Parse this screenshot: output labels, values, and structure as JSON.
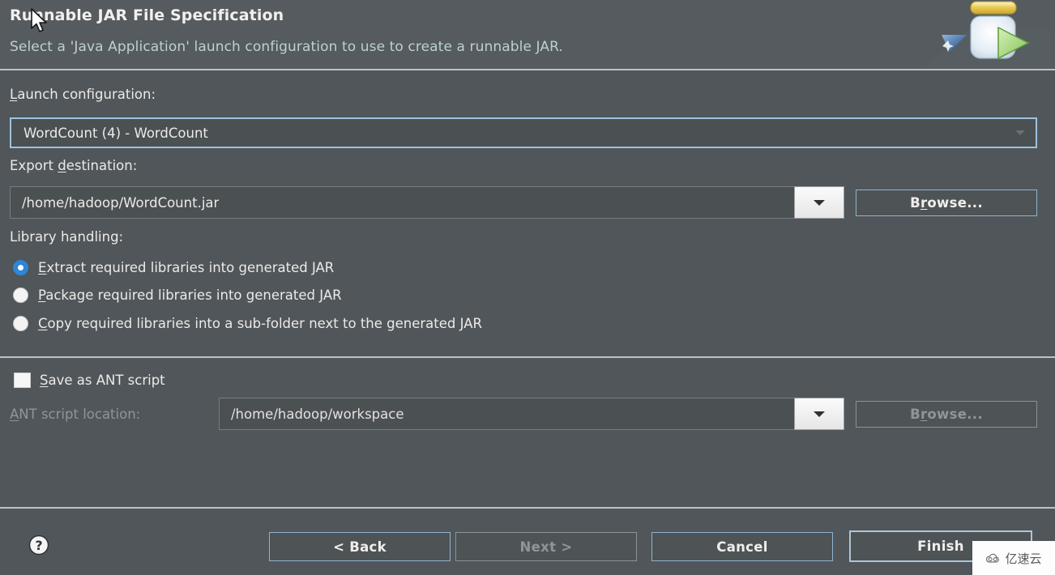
{
  "header": {
    "title": "Runnable JAR File Specification",
    "subtitle": "Select a 'Java Application' launch configuration to use to create a runnable JAR.",
    "icon": "runnable-jar-icon"
  },
  "launch_configuration": {
    "label_pre": "",
    "label_mnemonic": "L",
    "label_post": "aunch configuration:",
    "value": "WordCount (4) - WordCount",
    "dropdown_icon": "chevron-down-icon"
  },
  "export_destination": {
    "label_pre": "Export ",
    "label_mnemonic": "d",
    "label_post": "estination:",
    "value": "/home/hadoop/WordCount.jar",
    "dropdown_icon": "chevron-down-icon",
    "browse_pre": "B",
    "browse_mnemonic": "r",
    "browse_post": "owse...",
    "browse_label": "Browse..."
  },
  "library_handling": {
    "label": "Library handling:",
    "options": [
      {
        "mnemonic": "E",
        "pre": "",
        "post": "xtract required libraries into generated JAR",
        "full": "Extract required libraries into generated JAR",
        "selected": true
      },
      {
        "mnemonic": "P",
        "pre": "",
        "post": "ackage required libraries into generated JAR",
        "full": "Package required libraries into generated JAR",
        "selected": false
      },
      {
        "mnemonic": "C",
        "pre": "",
        "post": "opy required libraries into a sub-folder next to the generated JAR",
        "full": "Copy required libraries into a sub-folder next to the generated JAR",
        "selected": false
      }
    ]
  },
  "ant": {
    "save_checkbox": {
      "mnemonic": "S",
      "pre": "",
      "post": "ave as ANT script",
      "full": "Save as ANT script",
      "checked": false
    },
    "location_label_mnemonic": "A",
    "location_label_pre": "",
    "location_label_post": "NT script location:",
    "location_value": "/home/hadoop/workspace",
    "dropdown_icon": "chevron-down-icon",
    "browse_pre": "B",
    "browse_mnemonic": "r",
    "browse_post": "owse...",
    "browse_label": "Browse...",
    "browse_disabled": true
  },
  "footer": {
    "help_icon": "help-question-icon",
    "buttons": [
      {
        "label": "< Back",
        "disabled": false,
        "default": false
      },
      {
        "label": "Next >",
        "disabled": true,
        "default": false
      },
      {
        "label": "Cancel",
        "disabled": false,
        "default": false
      },
      {
        "label": "Finish",
        "disabled": false,
        "default": true
      }
    ]
  },
  "watermark": {
    "text": "亿速云",
    "icon": "cloud-icon"
  },
  "colors": {
    "dialog_bg": "#50565a",
    "header_bg": "#555b5e",
    "accent_blue": "#2f86d6",
    "focus_border": "#9fc2de",
    "subtitle": "#bcd0d6",
    "separator": "#b9c3c7",
    "disabled_text": "#8f9699"
  }
}
